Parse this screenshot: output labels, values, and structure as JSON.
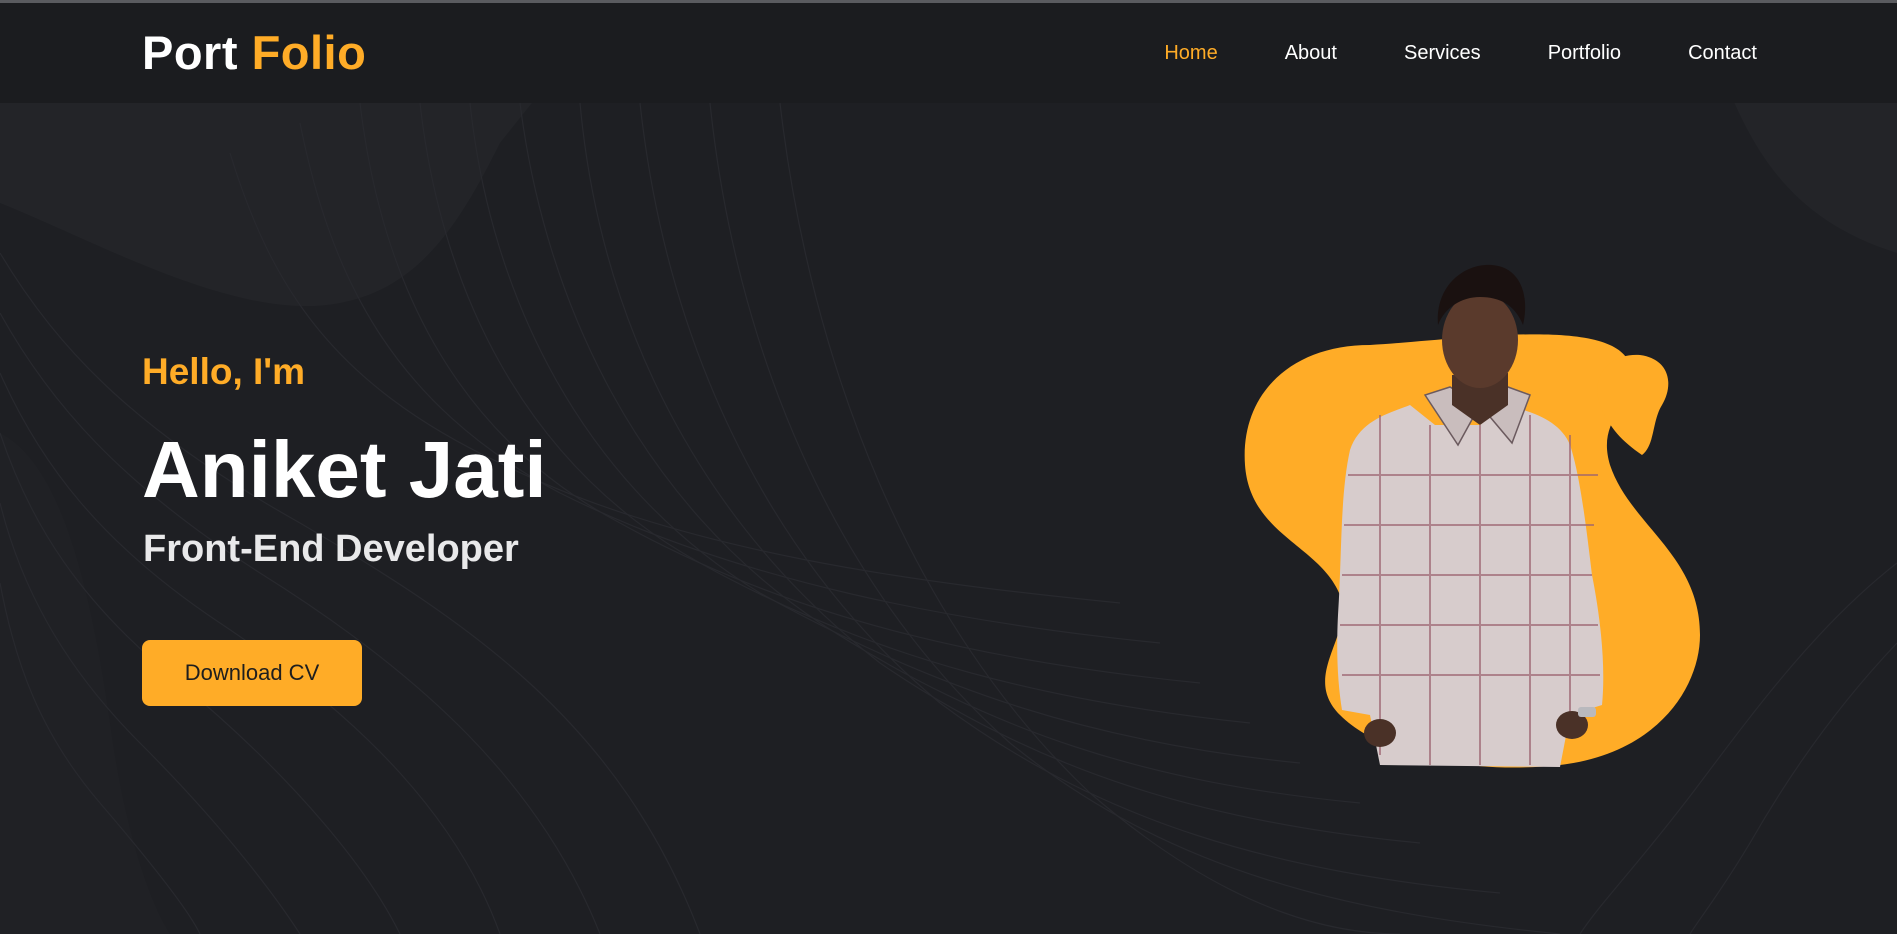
{
  "header": {
    "logo_primary": "Port",
    "logo_accent": "Folio"
  },
  "nav": {
    "items": [
      {
        "label": "Home",
        "active": true
      },
      {
        "label": "About",
        "active": false
      },
      {
        "label": "Services",
        "active": false
      },
      {
        "label": "Portfolio",
        "active": false
      },
      {
        "label": "Contact",
        "active": false
      }
    ]
  },
  "hero": {
    "greeting": "Hello, I'm",
    "name": "Aniket Jati",
    "role": "Front-End Developer",
    "cta_label": "Download CV",
    "image": "portrait-photo"
  },
  "colors": {
    "accent": "#ffac27",
    "background": "#1e1f23",
    "header_background": "#1b1c1f",
    "text": "#ffffff"
  }
}
